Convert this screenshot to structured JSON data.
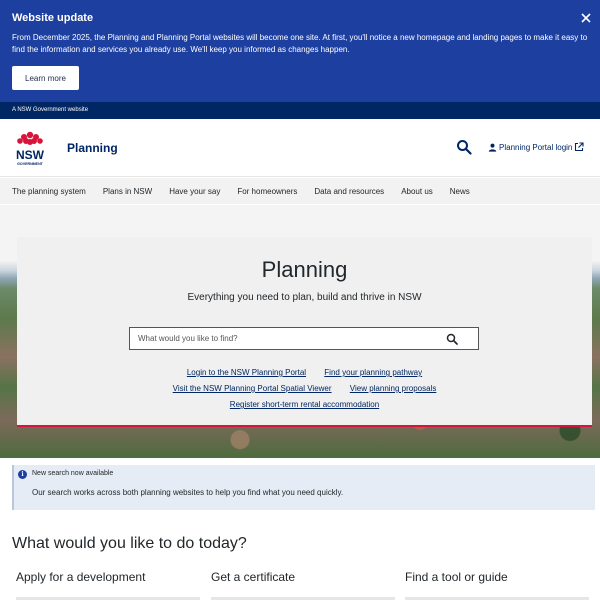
{
  "update_banner": {
    "title": "Website update",
    "text": "From December 2025, the Planning and Planning Portal websites will become one site. At first, you'll notice a new homepage and landing pages to make it easy to find the information and services you already use. We'll keep you informed as changes happen.",
    "button_label": "Learn more",
    "close_icon": "close-icon"
  },
  "gov_strip": {
    "text": "A NSW Government website"
  },
  "header": {
    "logo_text": "NSW",
    "logo_subtext": "GOVERNMENT",
    "site_name": "Planning",
    "search_icon": "search-icon",
    "login_label": "Planning Portal login"
  },
  "nav": {
    "items": [
      {
        "label": "The planning system"
      },
      {
        "label": "Plans in NSW"
      },
      {
        "label": "Have your say"
      },
      {
        "label": "For homeowners"
      },
      {
        "label": "Data and resources"
      },
      {
        "label": "About us"
      },
      {
        "label": "News"
      }
    ]
  },
  "hero": {
    "title": "Planning",
    "subtitle": "Everything you need to plan, build and thrive in NSW",
    "search_placeholder": "What would you like to find?",
    "links": {
      "row1": [
        "Login to the NSW Planning Portal",
        "Find your planning pathway"
      ],
      "row2": [
        "Visit the NSW Planning Portal Spatial Viewer",
        "View planning proposals"
      ],
      "row3": [
        "Register short-term rental accommodation"
      ]
    }
  },
  "notice": {
    "title": "New search now available",
    "text": "Our search works across both planning websites to help you find what you need quickly."
  },
  "tasks": {
    "title": "What would you like to do today?",
    "cards": [
      {
        "label": "Apply for a development"
      },
      {
        "label": "Get a certificate"
      },
      {
        "label": "Find a tool or guide"
      }
    ]
  },
  "colors": {
    "banner": "#1d3fa0",
    "gov_strip": "#002664",
    "accent_red": "#d7153a",
    "link": "#002664"
  }
}
